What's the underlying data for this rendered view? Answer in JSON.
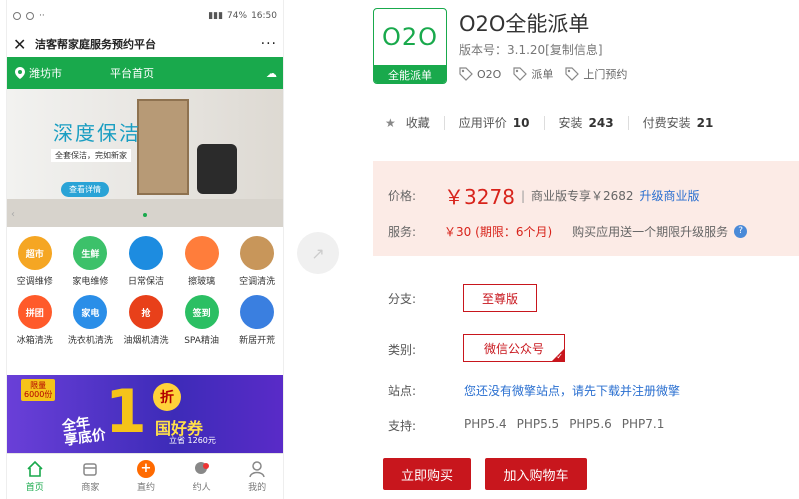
{
  "phone": {
    "status_time": "16:50",
    "status_battery": "74%",
    "wx_title": "洁客帮家庭服务预约平台",
    "wx_more": "···",
    "city": "潍坊市",
    "home_title": "平台首页",
    "banner": {
      "headline": "深度保洁",
      "sub": "全套保洁，完如新家",
      "button": "查看详情"
    },
    "services": [
      {
        "label": "空调维修",
        "icon_text": "超市",
        "color": "#f5a623"
      },
      {
        "label": "家电维修",
        "icon_text": "生鲜",
        "color": "#3cc16a"
      },
      {
        "label": "日常保洁",
        "icon_text": "",
        "color": "#1d8ce0"
      },
      {
        "label": "擦玻璃",
        "icon_text": "",
        "color": "#ff7d3b"
      },
      {
        "label": "空调清洗",
        "icon_text": "",
        "color": "#c8965a"
      },
      {
        "label": "冰箱清洗",
        "icon_text": "拼团",
        "color": "#ff5a2a"
      },
      {
        "label": "洗衣机清洗",
        "icon_text": "家电",
        "color": "#2a8ee8"
      },
      {
        "label": "油烟机清洗",
        "icon_text": "抢",
        "color": "#e8401a"
      },
      {
        "label": "SPA精油",
        "icon_text": "签到",
        "color": "#2bbf63"
      },
      {
        "label": "新居开荒",
        "icon_text": "",
        "color": "#3a7fe0"
      }
    ],
    "promo": {
      "badge": "限量\n6000份",
      "big": "1",
      "zhe": "折",
      "t1": "全年\n享底价",
      "t2": "国好券",
      "t3": "立省 1260元"
    },
    "tabs": [
      {
        "label": "首页",
        "icon": "home-icon"
      },
      {
        "label": "商家",
        "icon": "shop-icon"
      },
      {
        "label": "直约",
        "icon": "plus-icon"
      },
      {
        "label": "约人",
        "icon": "chat-icon"
      },
      {
        "label": "我的",
        "icon": "user-icon"
      }
    ]
  },
  "app": {
    "logo_text": "O2O",
    "logo_sub": "全能派单",
    "title": "O2O全能派单",
    "version": "版本号：3.1.20[复制信息]",
    "tags": [
      "O2O",
      "派单",
      "上门预约"
    ],
    "favorite": "收藏",
    "rating_label": "应用评价",
    "rating_value": "10",
    "install_label": "安装",
    "install_value": "243",
    "paid_label": "付费安装",
    "paid_value": "21"
  },
  "pricing": {
    "price_label": "价格:",
    "price": "￥3278",
    "biz_text": "商业版专享￥2682",
    "upgrade_link": "升级商业版",
    "service_label": "服务:",
    "service_value": "￥30 (期限：6个月)",
    "service_note": "购买应用送一个期限升级服务",
    "help_icon": "?"
  },
  "options": {
    "branch_label": "分支:",
    "branch_value": "至尊版",
    "category_label": "类别:",
    "category_value": "微信公众号",
    "site_label": "站点:",
    "site_text": "您还没有微擎站点，请先下载并注册微擎",
    "support_label": "支持:",
    "support_list": [
      "PHP5.4",
      "PHP5.5",
      "PHP5.6",
      "PHP7.1"
    ]
  },
  "actions": {
    "buy": "立即购买",
    "cart": "加入购物车"
  },
  "colors": {
    "green": "#19a94c",
    "red": "#c8161d",
    "price_red": "#d8231b",
    "link_blue": "#2a6fd0"
  }
}
